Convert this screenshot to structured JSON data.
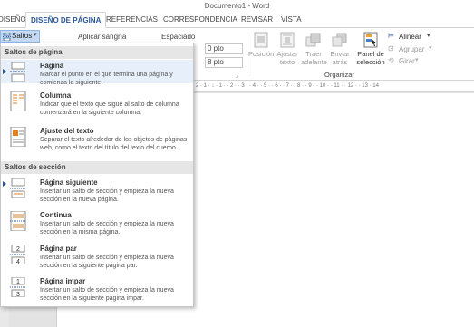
{
  "window": {
    "title": "Documento1 - Word"
  },
  "tabs": [
    {
      "label": "DISEÑO",
      "active": false
    },
    {
      "label": "DISEÑO DE PÁGINA",
      "active": true
    },
    {
      "label": "REFERENCIAS",
      "active": false
    },
    {
      "label": "CORRESPONDENCIA",
      "active": false
    },
    {
      "label": "REVISAR",
      "active": false
    },
    {
      "label": "VISTA",
      "active": false
    }
  ],
  "ribbon": {
    "saltos_label": "Saltos",
    "indent_label": "Aplicar sangría",
    "spacing_label": "Espaciado",
    "spacing_before": "0 pto",
    "spacing_after": "8 pto",
    "organizar_label": "Organizar",
    "buttons": [
      {
        "label": "Posición",
        "enabled": false,
        "icon": "position-icon"
      },
      {
        "label": "Ajustar texto",
        "enabled": false,
        "icon": "wrap-text-icon"
      },
      {
        "label": "Traer adelante",
        "enabled": false,
        "icon": "bring-forward-icon"
      },
      {
        "label": "Enviar atrás",
        "enabled": false,
        "icon": "send-backward-icon"
      },
      {
        "label": "Panel de selección",
        "enabled": true,
        "icon": "selection-pane-icon"
      }
    ],
    "alinear_label": "Alinear",
    "agrupar_label": "Agrupar",
    "girar_label": "Girar"
  },
  "ruler": {
    "text": "2 · 1 · ↓ · 1 · · 2 · · 3 · · 4 · · 5 · · 6 · · 7 · · 8 · · 9 · · 10 · · 11 · · 12 · · 13 · 14"
  },
  "menu": {
    "section1": "Saltos de página",
    "section2": "Saltos de sección",
    "items": [
      {
        "title": "Página",
        "desc": "Marcar el punto en el que termina una página y comienza la siguiente.",
        "icon": "page-break-icon"
      },
      {
        "title": "Columna",
        "desc": "Indicar que el texto que sigue al salto de columna comenzará en la siguiente columna.",
        "icon": "column-break-icon"
      },
      {
        "title": "Ajuste del texto",
        "desc": "Separar el texto alrededor de los objetos de páginas web, como el texto del título del texto del cuerpo.",
        "icon": "text-wrapping-break-icon"
      },
      {
        "title": "Página siguiente",
        "desc": "Insertar un salto de sección y empieza la nueva sección en la nueva página.",
        "icon": "next-page-break-icon"
      },
      {
        "title": "Continua",
        "desc": "Insertar un salto de sección y empieza la nueva sección en la misma página.",
        "icon": "continuous-break-icon"
      },
      {
        "title": "Página par",
        "desc": "Insertar un salto de sección y empieza la nueva sección en la siguiente página par.",
        "icon": "even-page-break-icon",
        "badge": "2"
      },
      {
        "title": "Página impar",
        "desc": "Insertar un salto de sección y empieza la nueva sección en la siguiente página impar.",
        "icon": "odd-page-break-icon",
        "badge": "1"
      }
    ]
  },
  "colors": {
    "accent": "#2b579a",
    "hover": "#e7f0fa",
    "ribbon_bg": "#ffffff",
    "workspace": "#e3e3e3"
  }
}
